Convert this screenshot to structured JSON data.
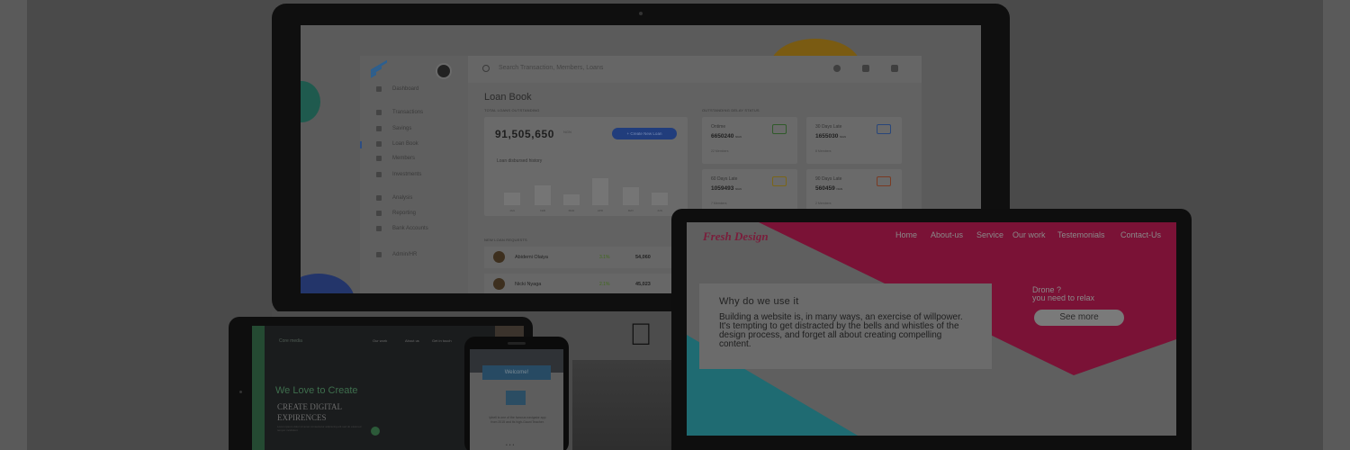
{
  "dashboard": {
    "search_placeholder": "Search Transaction, Members, Loans",
    "nav": [
      "Dashboard",
      "Transactions",
      "Savings",
      "Loan Book",
      "Members",
      "Investments",
      "Analysis",
      "Reporting",
      "Bank Accounts",
      "Admin/HR"
    ],
    "page_title": "Loan Book",
    "total_label": "TOTAL LOANS OUTSTANDING",
    "total_value": "91,505,650",
    "total_unit": "NGN",
    "create_button": "+ Create New Loan",
    "chart_title": "Loan disbursed history",
    "months": [
      "JAN",
      "FEB",
      "MAR",
      "APR",
      "MAY",
      "JUN"
    ],
    "status_label": "OUTSTANDING DELAY STATUS",
    "stats": [
      {
        "title": "Ontime",
        "value": "6650240",
        "unit": "NGN",
        "sub": "22 Members"
      },
      {
        "title": "30 Days Late",
        "value": "1655030",
        "unit": "NGN",
        "sub": "8 Members"
      },
      {
        "title": "60 Days Late",
        "value": "1059493",
        "unit": "NGN",
        "sub": "7 Members"
      },
      {
        "title": "90 Days Late",
        "value": "560459",
        "unit": "NGN",
        "sub": "2 Members"
      }
    ],
    "requests_label": "NEW LOAN REQUESTS",
    "requests": [
      {
        "name": "Abidemi Olaiya",
        "pct": "3.1%",
        "amount": "54,060"
      },
      {
        "name": "Nicki Nyaga",
        "pct": "2.1%",
        "amount": "45,023"
      }
    ]
  },
  "tablet": {
    "brand": "Core media",
    "nav": [
      "Our work",
      "About us",
      "Get in touch"
    ],
    "headline": "We Love to Create",
    "subhead": "CREATE DIGITAL EXPIRENCES",
    "body": "Lorem ipsum dolor sit amet consectetur adipiscing elit sed do eiusmod tempor incididunt"
  },
  "phone": {
    "banner": "Welcome!",
    "body": "Iphell is one of the famous navigator app from 2015 and its high-Gauni Teacher."
  },
  "laptop": {
    "logo": "Fresh Design",
    "nav": [
      "Home",
      "About-us",
      "Service",
      "Our work",
      "Testemonials",
      "Contact-Us"
    ],
    "card_title": "Why do we use it",
    "card_body": "Building a website is, in many ways, an exercise of willpower. It's tempting to get distracted by the bells and whistles of the design process, and forget all about creating compelling content.",
    "side_line1": "Drone ?",
    "side_line2": "you need to relax",
    "cta": "See more"
  },
  "colors": {
    "pink": "#e8185c",
    "teal": "#3cc7d2",
    "brand_blue": "#3f6fd9"
  }
}
